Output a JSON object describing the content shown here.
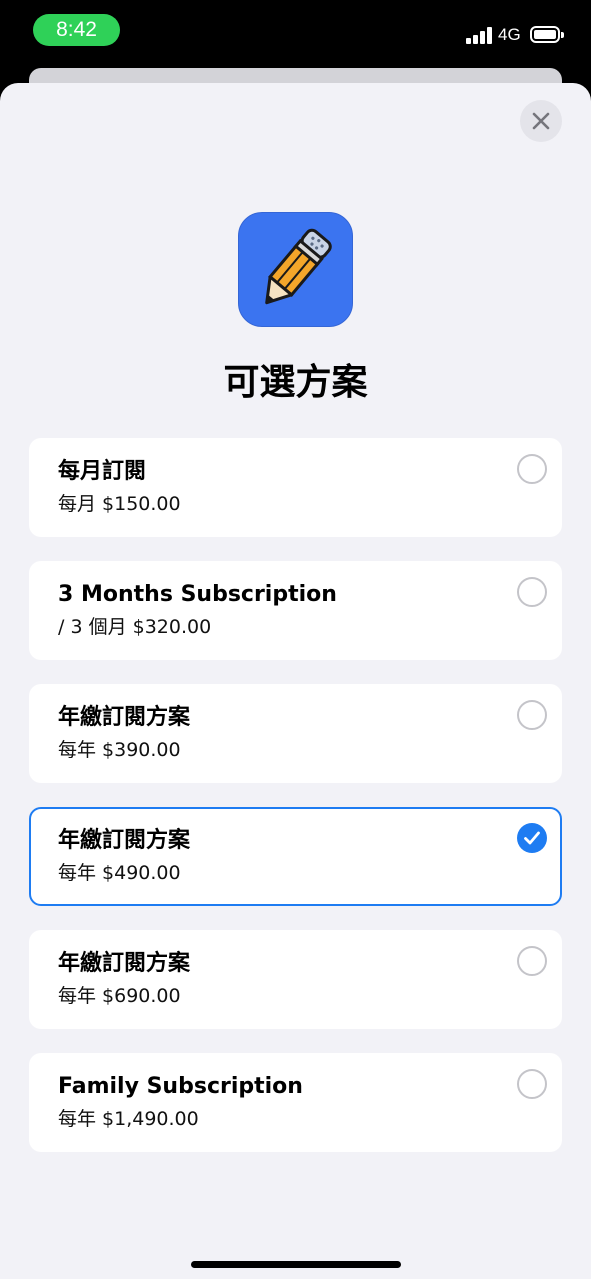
{
  "status_bar": {
    "time": "8:42",
    "network": "4G",
    "time_pill_color": "#2fd158"
  },
  "sheet": {
    "title": "可選方案",
    "app_icon": "pencil-app-icon",
    "close_icon": "close-icon"
  },
  "plans": [
    {
      "name": "每月訂閱",
      "price": "每月 $150.00",
      "selected": false
    },
    {
      "name": "3 Months Subscription",
      "price": "/ 3 個月 $320.00",
      "selected": false
    },
    {
      "name": "年繳訂閱方案",
      "price": "每年 $390.00",
      "selected": false
    },
    {
      "name": "年繳訂閱方案",
      "price": "每年 $490.00",
      "selected": true
    },
    {
      "name": "年繳訂閱方案",
      "price": "每年 $690.00",
      "selected": false
    },
    {
      "name": "Family Subscription",
      "price": "每年 $1,490.00",
      "selected": false
    }
  ],
  "colors": {
    "accent": "#1e7cf2",
    "app_icon_bg": "#3b74f0",
    "sheet_bg": "#f2f2f7"
  }
}
